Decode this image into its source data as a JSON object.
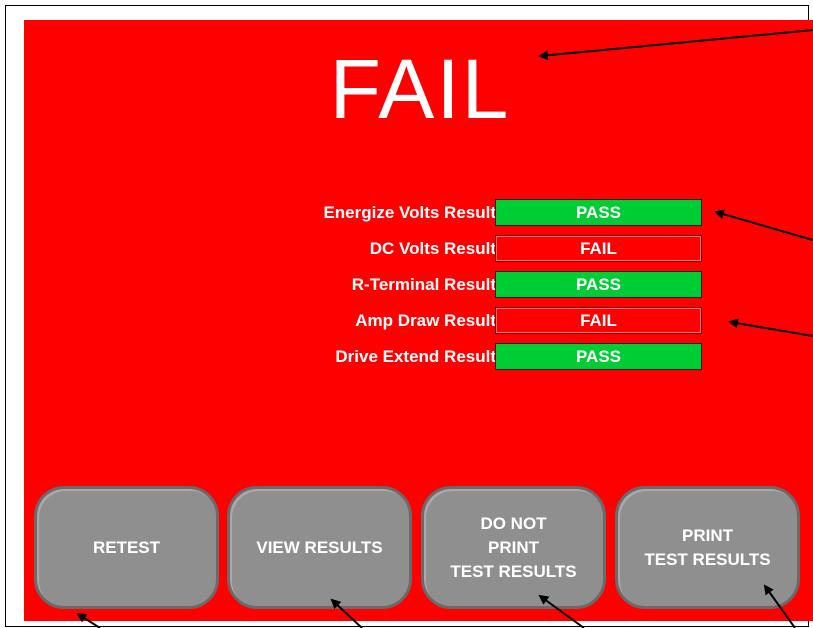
{
  "overall_status": "FAIL",
  "results": [
    {
      "label": "Energize Volts Result",
      "value": "PASS",
      "status": "pass"
    },
    {
      "label": "DC Volts Result",
      "value": "FAIL",
      "status": "fail"
    },
    {
      "label": "R-Terminal Result",
      "value": "PASS",
      "status": "pass"
    },
    {
      "label": "Amp Draw Result",
      "value": "FAIL",
      "status": "fail"
    },
    {
      "label": "Drive Extend Result",
      "value": "PASS",
      "status": "pass"
    }
  ],
  "buttons": {
    "retest": "RETEST",
    "view_results": "VIEW RESULTS",
    "do_not_print": "DO NOT\nPRINT\nTEST RESULTS",
    "print_results": "PRINT\nTEST RESULTS"
  },
  "colors": {
    "panel_background": "#ff0000",
    "pass": "#00cc33",
    "fail": "#ff0000",
    "button": "#8f8f8f",
    "text": "#ffffff"
  }
}
